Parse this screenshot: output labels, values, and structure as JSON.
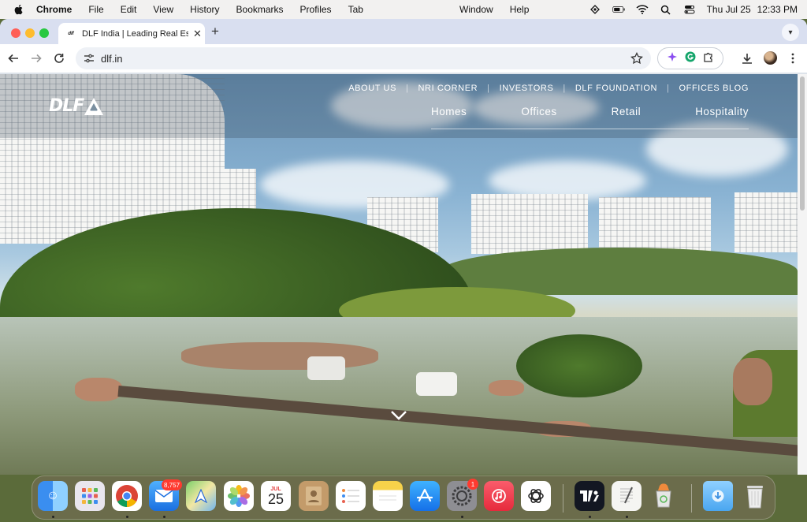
{
  "menubar": {
    "app_name": "Chrome",
    "items": [
      "File",
      "Edit",
      "View",
      "History",
      "Bookmarks",
      "Profiles",
      "Tab",
      "Window",
      "Help"
    ],
    "date": "Thu Jul 25",
    "time": "12:33 PM"
  },
  "browser": {
    "tab_title": "DLF India | Leading Real Estate",
    "tab_favicon_text": "dlf",
    "url": "dlf.in"
  },
  "site": {
    "logo_text": "DLF",
    "top_links": [
      "ABOUT US",
      "NRI CORNER",
      "INVESTORS",
      "DLF FOUNDATION",
      "OFFICES BLOG"
    ],
    "main_links": [
      "Homes",
      "Offices",
      "Retail",
      "Hospitality"
    ]
  },
  "dock": {
    "calendar_month": "JUL",
    "calendar_day": "25",
    "mail_badge": "8,757",
    "settings_badge": "1"
  },
  "colors": {
    "accent_blue": "#1a73e8",
    "badge_red": "#ff3b30"
  }
}
